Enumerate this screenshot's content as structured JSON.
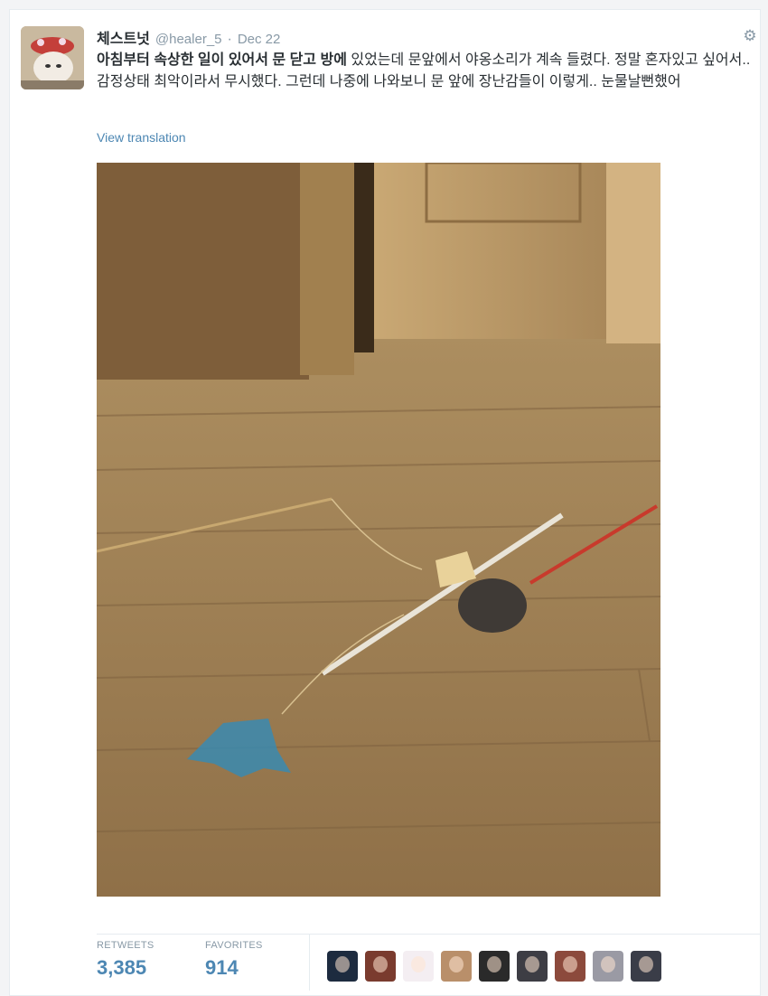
{
  "tweet": {
    "display_name": "체스트넛",
    "handle": "@healer_5",
    "separator": "·",
    "date": "Dec 22",
    "text_bold": "아침부터 속상한 일이 있어서 문 닫고 방에",
    "text_rest": " 있었는데 문앞에서 야옹소리가 계속 들렸다. 정말 혼자있고 싶어서.. 감정상태 최악이라서 무시했다. 그런데 나중에 나와보니 문 앞에 장난감들이 이렇게.. 눈물날뻔했어",
    "translate_link": "View translation"
  },
  "stats": {
    "retweets_label": "RETWEETS",
    "retweets_value": "3,385",
    "favorites_label": "FAVORITES",
    "favorites_value": "914"
  },
  "icons": {
    "gear": "gear-icon"
  },
  "colors": {
    "link": "#4d87b3",
    "muted": "#8899a6",
    "text": "#292f33"
  },
  "favoriters": [
    {
      "name": "avatar-1",
      "color": "#1d2b3f"
    },
    {
      "name": "avatar-2",
      "color": "#7a3b2e"
    },
    {
      "name": "avatar-3",
      "color": "#f4eef2"
    },
    {
      "name": "avatar-4",
      "color": "#b98f6a"
    },
    {
      "name": "avatar-5",
      "color": "#2a2a2a"
    },
    {
      "name": "avatar-6",
      "color": "#3d3d44"
    },
    {
      "name": "avatar-7",
      "color": "#8c4a3c"
    },
    {
      "name": "avatar-8",
      "color": "#9a9aa4"
    },
    {
      "name": "avatar-9",
      "color": "#3a3d48"
    }
  ]
}
